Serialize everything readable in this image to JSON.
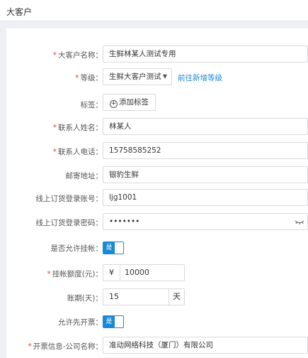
{
  "header": {
    "title": "大客户"
  },
  "form": {
    "customer_name": {
      "label": "大客户名称：",
      "value": "生鲜林某人测试专用"
    },
    "level": {
      "label": "等级：",
      "value": "生鲜大客户测试",
      "link": "前往新增等级"
    },
    "tags": {
      "label": "标签：",
      "button": "添加标签"
    },
    "contact_name": {
      "label": "联系人姓名：",
      "value": "林某人"
    },
    "contact_phone": {
      "label": "联系人电话：",
      "value": "15758585252"
    },
    "address": {
      "label": "邮寄地址：",
      "value": "银豹生鲜"
    },
    "login_account": {
      "label": "线上订货登录账号：",
      "value": "ljg1001"
    },
    "login_password": {
      "label": "线上订货登录密码：",
      "value": "•••••••"
    },
    "allow_credit": {
      "label": "是否允许挂帐：",
      "value": "是"
    },
    "credit_limit": {
      "label": "挂帐额度(元)：",
      "prefix": "¥",
      "value": "10000"
    },
    "payment_term": {
      "label": "账期(天)：",
      "value": "15",
      "unit": "天"
    },
    "allow_invoice": {
      "label": "允许先开票：",
      "value": "是"
    },
    "invoice_company": {
      "label": "开票信息-公司名称：",
      "value": "准动网络科技（厦门）有限公司"
    }
  },
  "colors": {
    "accent": "#1a8ad6",
    "required": "#e5413b"
  }
}
